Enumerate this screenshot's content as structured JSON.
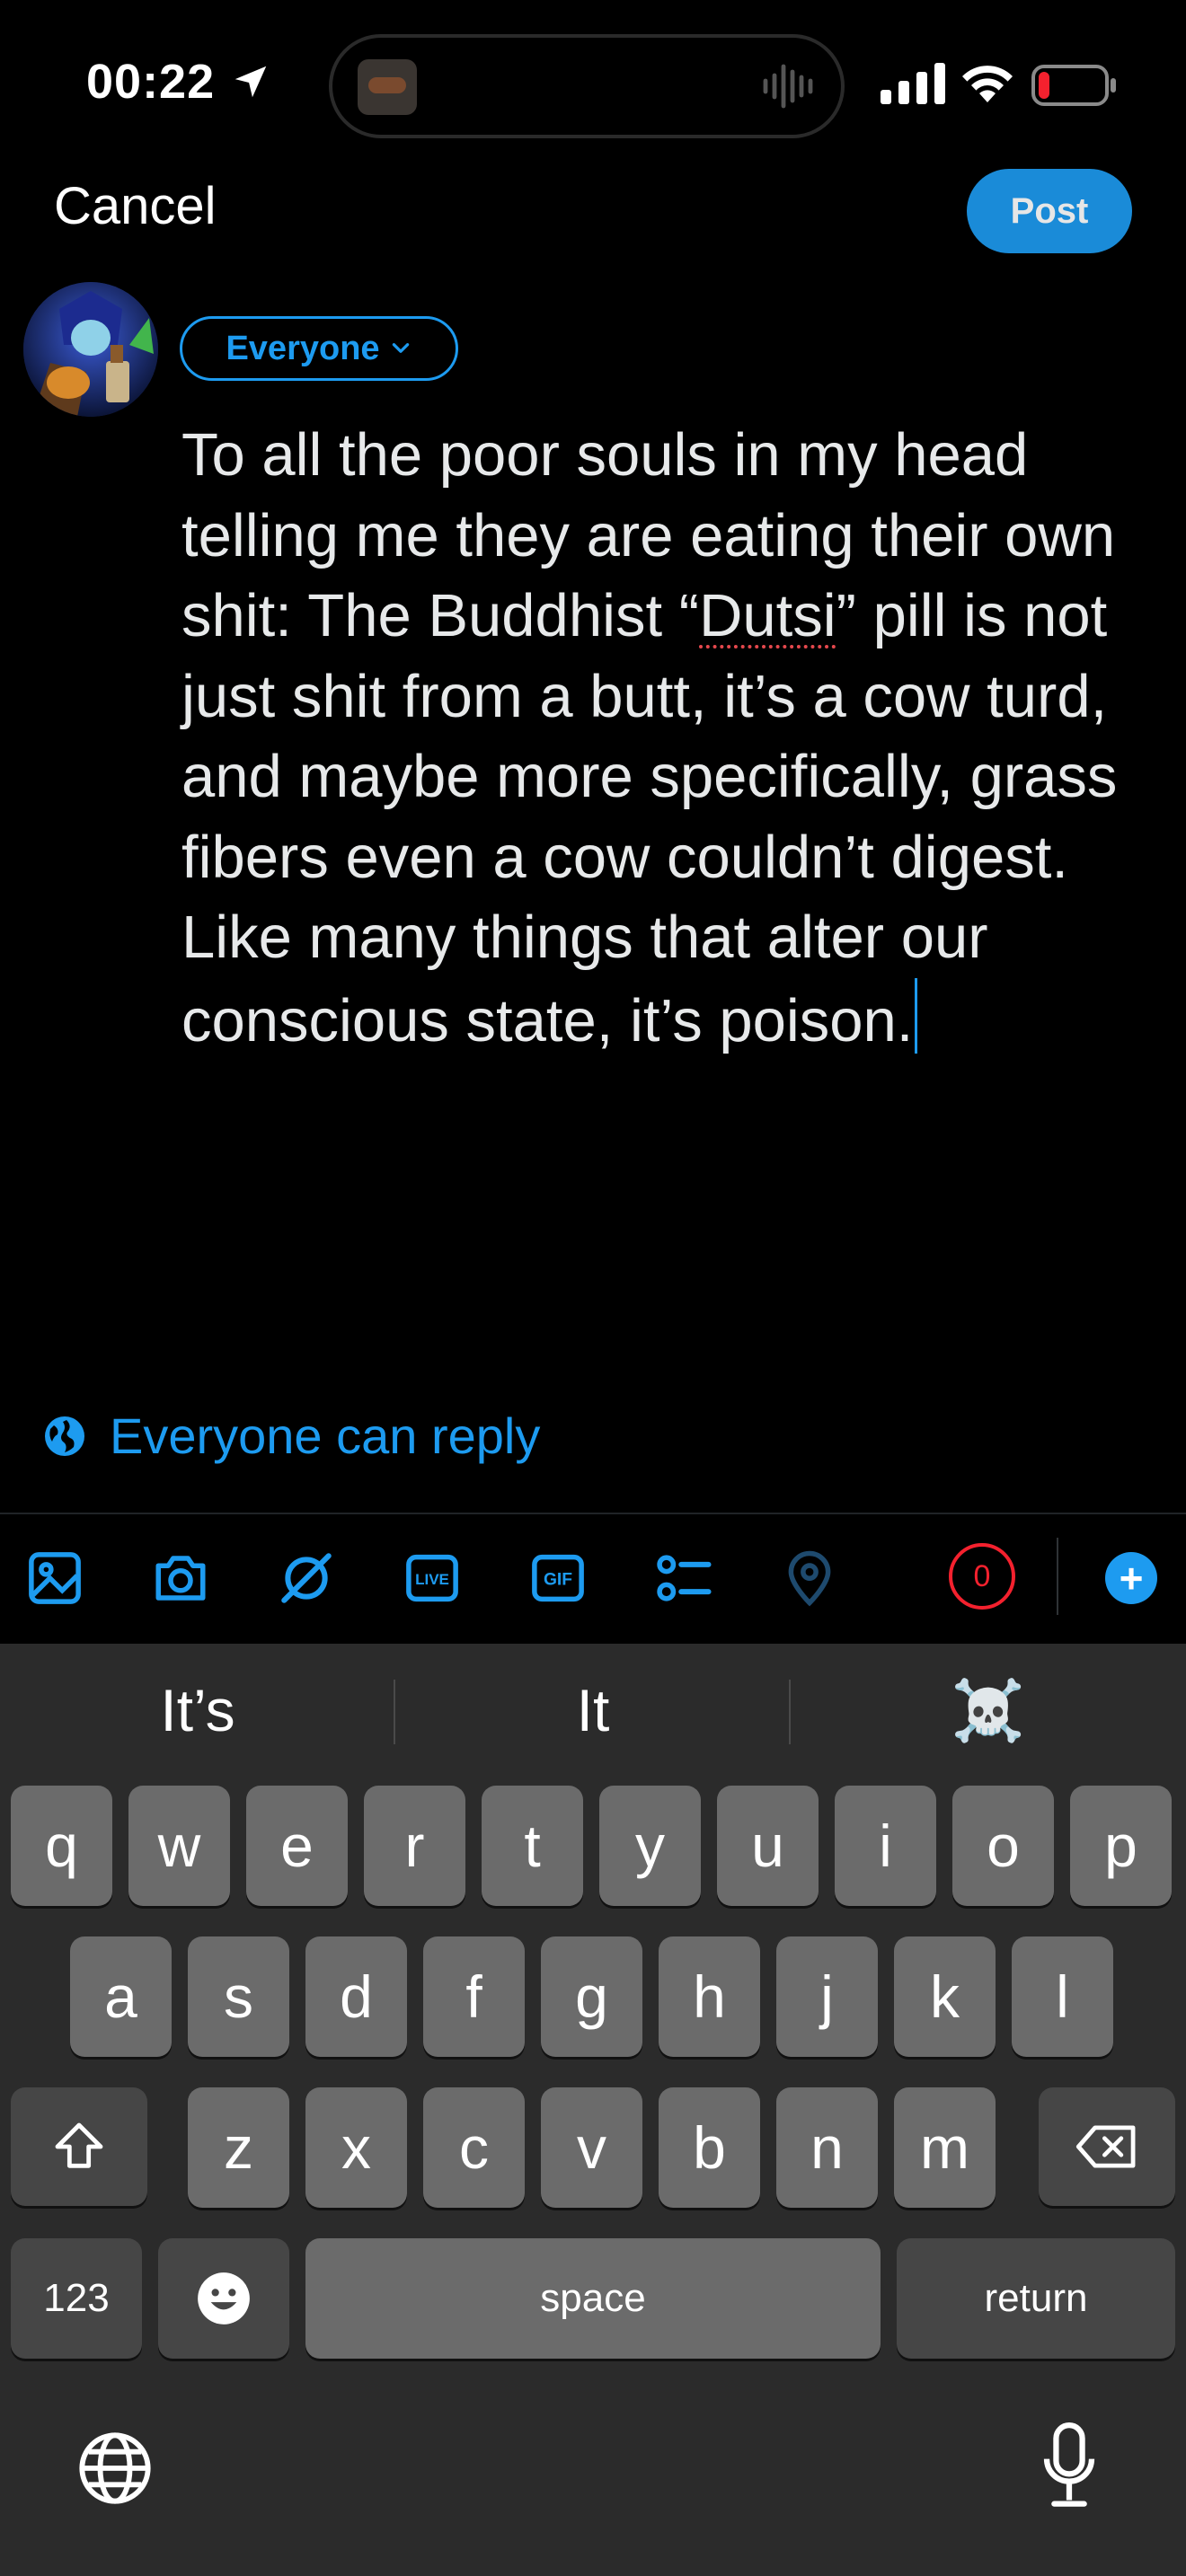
{
  "status_bar": {
    "time": "00:22"
  },
  "header": {
    "cancel_label": "Cancel",
    "post_label": "Post"
  },
  "composer": {
    "audience_label": "Everyone",
    "text_before": "To all the poor souls in my head telling me they are eating their own shit: The Buddhist “",
    "misspelled_word": "Dutsi",
    "text_after": "” pill is not just shit from a butt, it’s a cow turd, and maybe more specifically, grass fibers even a cow couldn’t digest. Like many things that alter our conscious state, it’s poison.",
    "reply_setting_label": "Everyone can reply"
  },
  "toolbar": {
    "icons": [
      "image-icon",
      "camera-icon",
      "grok-icon",
      "live-icon",
      "gif-icon",
      "poll-icon",
      "location-pin-icon"
    ],
    "live_label": "LIVE",
    "gif_label": "GIF",
    "char_count": "0",
    "add_label": "+"
  },
  "keyboard": {
    "suggestions": [
      "It’s",
      "It",
      "☠️"
    ],
    "row1": [
      "q",
      "w",
      "e",
      "r",
      "t",
      "y",
      "u",
      "i",
      "o",
      "p"
    ],
    "row2": [
      "a",
      "s",
      "d",
      "f",
      "g",
      "h",
      "j",
      "k",
      "l"
    ],
    "row3": [
      "z",
      "x",
      "c",
      "v",
      "b",
      "n",
      "m"
    ],
    "numbers_label": "123",
    "emoji_label": "☻",
    "space_label": "space",
    "return_label": "return"
  },
  "colors": {
    "accent": "#1d9bf0",
    "background": "#000000",
    "keyboard_bg": "#2b2b2b",
    "key_bg": "#6b6b6b",
    "error": "#f4212e"
  }
}
